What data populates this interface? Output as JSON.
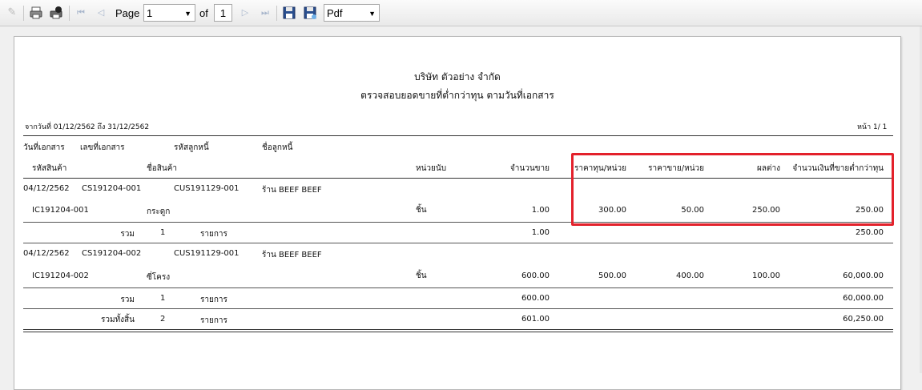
{
  "toolbar": {
    "page_label": "Page",
    "page_value": "1",
    "of_label": "of",
    "total_pages": "1",
    "export_format": "Pdf"
  },
  "report": {
    "company": "บริษัท ตัวอย่าง จำกัด",
    "title": "ตรวจสอบยอดขายที่ต่ำกว่าทุน ตามวันที่เอกสาร",
    "date_range": "จากวันที่ 01/12/2562 ถึง 31/12/2562",
    "page_info": "หน้า 1/ 1",
    "headers1": {
      "doc_date": "วันที่เอกสาร",
      "doc_no": "เลขที่เอกสาร",
      "customer_code": "รหัสลูกหนี้",
      "customer_name": "ชื่อลูกหนี้"
    },
    "headers2": {
      "product_code": "รหัสสินค้า",
      "product_name": "ชื่อสินค้า",
      "unit": "หน่วยนับ",
      "qty": "จำนวนขาย",
      "cost_per_unit": "ราคาทุน/หน่วย",
      "price_per_unit": "ราคาขาย/หน่วย",
      "difference": "ผลต่าง",
      "amount_below_cost": "จำนวนเงินที่ขายต่ำกว่าทุน"
    },
    "docs": [
      {
        "date": "04/12/2562",
        "doc_no": "CS191204-001",
        "customer_code": "CUS191129-001",
        "customer_name": "ร้าน BEEF BEEF",
        "item": {
          "code": "IC191204-001",
          "name": "กระดูก",
          "unit": "ชิ้น",
          "qty": "1.00",
          "cost": "300.00",
          "price": "50.00",
          "diff": "250.00",
          "amount": "250.00"
        },
        "subtotal": {
          "label": "รวม",
          "count": "1",
          "count_unit": "รายการ",
          "qty": "1.00",
          "amount": "250.00"
        }
      },
      {
        "date": "04/12/2562",
        "doc_no": "CS191204-002",
        "customer_code": "CUS191129-001",
        "customer_name": "ร้าน BEEF BEEF",
        "item": {
          "code": "IC191204-002",
          "name": "ซี่โครง",
          "unit": "ชิ้น",
          "qty": "600.00",
          "cost": "500.00",
          "price": "400.00",
          "diff": "100.00",
          "amount": "60,000.00"
        },
        "subtotal": {
          "label": "รวม",
          "count": "1",
          "count_unit": "รายการ",
          "qty": "600.00",
          "amount": "60,000.00"
        }
      }
    ],
    "grand_total": {
      "label": "รวมทั้งสิ้น",
      "count": "2",
      "count_unit": "รายการ",
      "qty": "601.00",
      "amount": "60,250.00"
    }
  },
  "colors": {
    "highlight": "#e3212b"
  }
}
